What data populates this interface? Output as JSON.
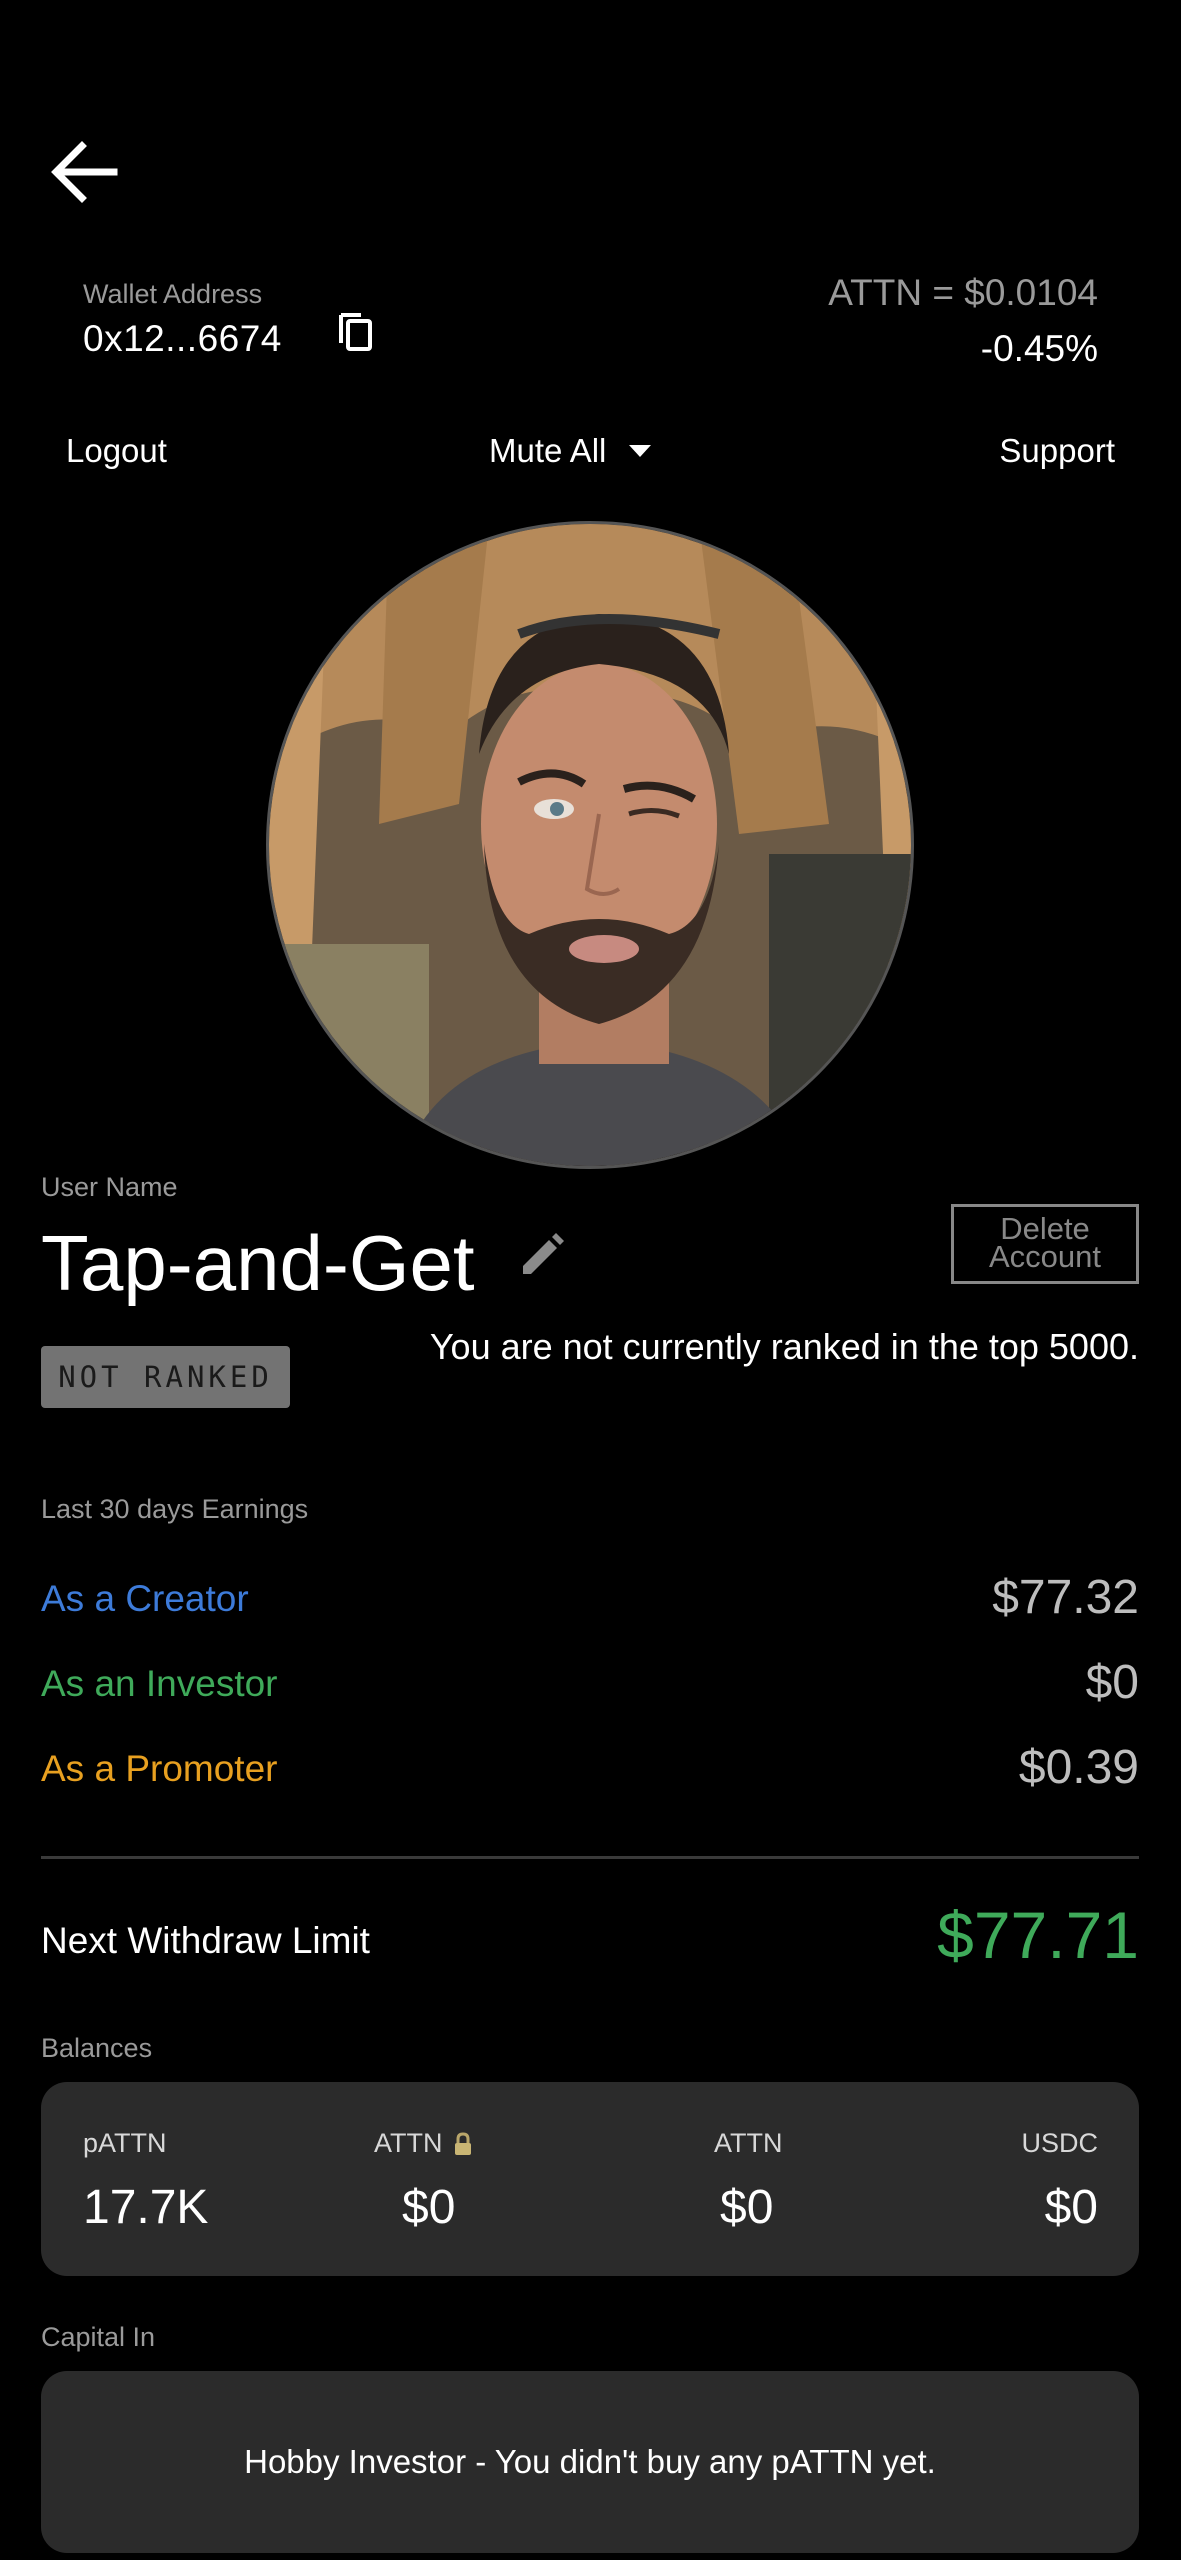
{
  "header": {
    "back_icon": "arrow-left-icon",
    "wallet_label": "Wallet Address",
    "wallet_address": "0x12...6674",
    "copy_icon": "copy-icon",
    "price": "ATTN = $0.0104",
    "price_change": "-0.45%"
  },
  "menu": {
    "logout": "Logout",
    "mute_all": "Mute All",
    "support": "Support"
  },
  "profile": {
    "user_name_label": "User Name",
    "user_name": "Tap-and-Get",
    "edit_icon": "pencil-icon",
    "delete_account": "Delete Account",
    "rank_badge": "NOT RANKED",
    "rank_text": "You are not currently ranked in the top 5000."
  },
  "earnings": {
    "label": "Last 30 days Earnings",
    "creator_label": "As a Creator",
    "creator_value": "$77.32",
    "investor_label": "As an Investor",
    "investor_value": "$0",
    "promoter_label": "As a Promoter",
    "promoter_value": "$0.39"
  },
  "withdraw": {
    "label": "Next Withdraw Limit",
    "value": "$77.71"
  },
  "balances": {
    "label": "Balances",
    "items": [
      {
        "name": "pATTN",
        "value": "17.7K"
      },
      {
        "name": "ATTN",
        "value": "$0",
        "icon": "lock-icon"
      },
      {
        "name": "ATTN",
        "value": "$0"
      },
      {
        "name": "USDC",
        "value": "$0"
      }
    ]
  },
  "capital": {
    "label": "Capital In",
    "text": "Hobby Investor - You didn't buy any pATTN yet."
  },
  "colors": {
    "creator": "#3d7bd9",
    "investor": "#3faa5a",
    "promoter": "#e8a020",
    "withdraw": "#3faa5a"
  }
}
